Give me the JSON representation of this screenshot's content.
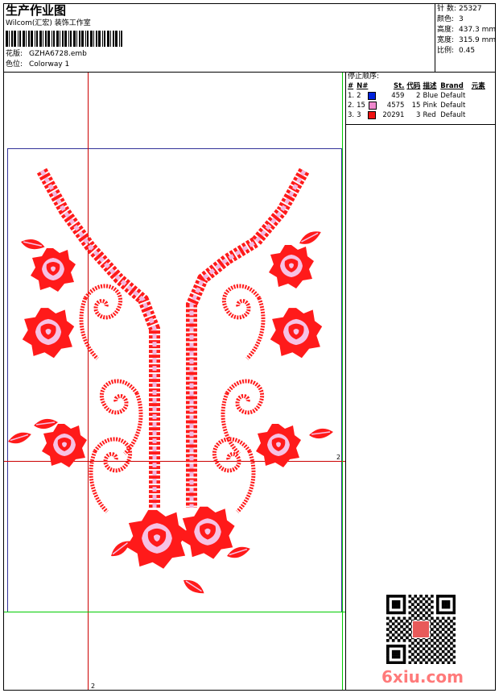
{
  "header": {
    "title": "生产作业图",
    "subtitle": "Wilcom(汇宏) 装饰工作室",
    "design_label": "花版:",
    "design_value": "GZHA6728.emb",
    "colorway_label": "色位:",
    "colorway_value": "Colorway 1"
  },
  "stats": [
    {
      "label": "针 数:",
      "value": "25327"
    },
    {
      "label": "颜色:",
      "value": "3"
    },
    {
      "label": "高度:",
      "value": "437.3 mm"
    },
    {
      "label": "宽度:",
      "value": "315.9 mm"
    },
    {
      "label": "比例:",
      "value": "0.45"
    }
  ],
  "stop_sequence": {
    "title": "停止顺序:",
    "headers": [
      "#",
      "N#",
      "St.",
      "代码",
      "描述",
      "Brand",
      "元素"
    ],
    "rows": [
      {
        "index": "1.",
        "needle": "2",
        "color": "#0022dd",
        "stitches": "459",
        "code": "2",
        "desc": "Blue",
        "brand": "Default"
      },
      {
        "index": "2.",
        "needle": "15",
        "color": "#ee88cc",
        "stitches": "4575",
        "code": "15",
        "desc": "Pink",
        "brand": "Default"
      },
      {
        "index": "3.",
        "needle": "3",
        "color": "#ee1111",
        "stitches": "20291",
        "code": "3",
        "desc": "Red",
        "brand": "Default"
      }
    ]
  },
  "markers": {
    "right": "2",
    "bottom": "2"
  },
  "watermark": "6xiu.com",
  "colors": {
    "embroidery_red": "#ff1a1a",
    "embroidery_pink": "#f2b8e0",
    "guide_red": "#cc0000",
    "guide_green": "#00cc00",
    "guide_blue": "#333399"
  }
}
